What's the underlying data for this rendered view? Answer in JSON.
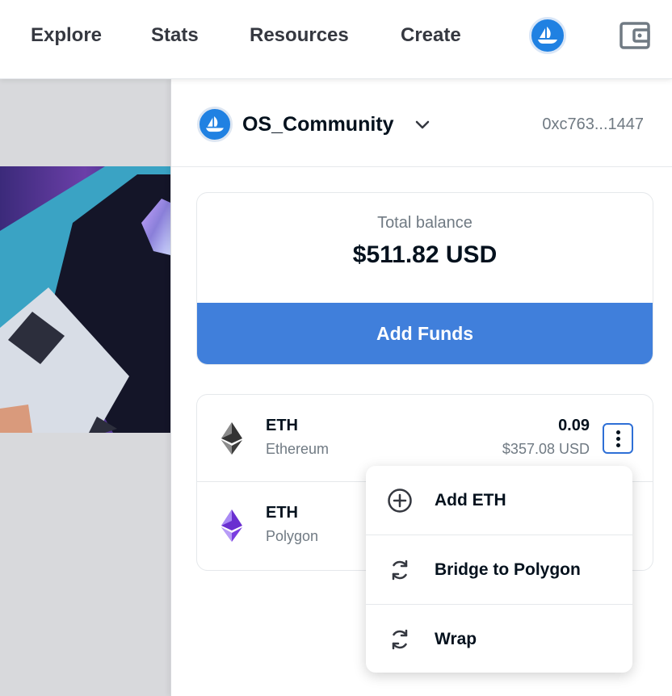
{
  "nav": {
    "links": [
      "Explore",
      "Stats",
      "Resources",
      "Create"
    ],
    "avatar_icon": "opensea-logo-icon",
    "wallet_icon": "wallet-icon"
  },
  "account": {
    "name": "OS_Community",
    "address": "0xc763...1447",
    "avatar_icon": "opensea-logo-icon",
    "dropdown_icon": "chevron-down-icon"
  },
  "balance": {
    "label": "Total balance",
    "value": "$511.82 USD",
    "add_funds_label": "Add Funds"
  },
  "tokens": [
    {
      "symbol": "ETH",
      "network": "Ethereum",
      "amount": "0.09",
      "usd": "$357.08 USD",
      "icon": "eth-icon",
      "color": "#343434"
    },
    {
      "symbol": "ETH",
      "network": "Polygon",
      "icon": "eth-icon",
      "color": "#8247e5"
    }
  ],
  "menu": {
    "items": [
      {
        "label": "Add ETH",
        "icon": "plus-circle-icon"
      },
      {
        "label": "Bridge to Polygon",
        "icon": "refresh-icon"
      },
      {
        "label": "Wrap",
        "icon": "refresh-icon"
      }
    ]
  },
  "colors": {
    "accent": "#407fdb",
    "brand_blue": "#2081e2",
    "text_primary": "#04111d",
    "text_secondary": "#707a83"
  }
}
